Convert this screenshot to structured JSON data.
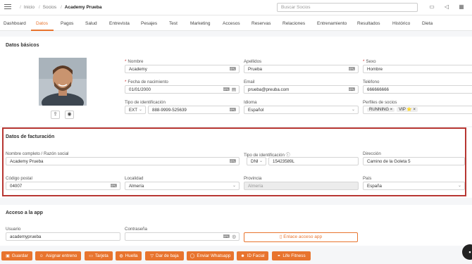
{
  "breadcrumb": {
    "home": "Inicio",
    "section": "Socios",
    "current": "Academy Prueba"
  },
  "search": {
    "placeholder": "Buscar Socios"
  },
  "tabs": [
    "Dashboard",
    "Datos",
    "Pagos",
    "Salud",
    "Entrevista",
    "Pesajes",
    "Test",
    "Marketing",
    "Accesos",
    "Reservas",
    "Relaciones",
    "Entrenamiento",
    "Resultados",
    "Histórico",
    "Dieta"
  ],
  "active_tab": "Datos",
  "basic": {
    "title": "Datos básicos",
    "nombre_label": "Nombre",
    "nombre": "Academy",
    "apellidos_label": "Apellidos",
    "apellidos": "Prueba",
    "sexo_label": "Sexo",
    "sexo": "Hombre",
    "fecha_label": "Fecha de nacimiento",
    "fecha": "01/01/2000",
    "email_label": "Email",
    "email": "prueba@preuba.com",
    "telefono_label": "Teléfono",
    "telefono": "666666666",
    "tipo_id_label": "Tipo de identificación",
    "tipo_id": "EXT",
    "id_value": "888-9999-525639",
    "idioma_label": "Idioma",
    "idioma": "Español",
    "perfiles_label": "Perfiles de socios",
    "perfiles": [
      "RUNNING ×",
      "VIP ⭐ ×"
    ]
  },
  "billing": {
    "title": "Datos de facturación",
    "nombre_label": "Nombre completo / Razón social",
    "nombre": "Academy Prueba",
    "tipo_id_label": "Tipo de identificación",
    "tipo_id": "DNI",
    "id_value": "15423589L",
    "direccion_label": "Dirección",
    "direccion": "Camino de la Goleta 5",
    "cp_label": "Código postal",
    "cp": "04007",
    "localidad_label": "Localidad",
    "localidad": "Almería",
    "provincia_label": "Provincia",
    "provincia": "Almería",
    "pais_label": "País",
    "pais": "España"
  },
  "access": {
    "title": "Acceso a la app",
    "usuario_label": "Usuario",
    "usuario": "academyprueba",
    "password_label": "Contraseña",
    "link_button": "Enlace acceso app"
  },
  "actions": [
    "Guardar",
    "Asignar entreno",
    "Tarjeta",
    "Huella",
    "Dar de baja",
    "Enviar Whatsapp",
    "ID Facial",
    "Life Fitness"
  ],
  "colors": {
    "accent": "#e8742e",
    "highlight": "#b73632"
  }
}
